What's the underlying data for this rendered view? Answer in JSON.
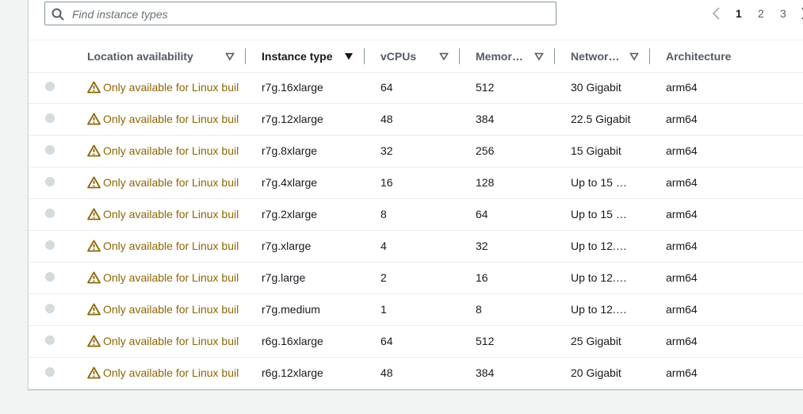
{
  "search": {
    "placeholder": "Find instance types",
    "value": ""
  },
  "pagination": {
    "pages": [
      "1",
      "2",
      "3"
    ],
    "current": "1"
  },
  "columns": [
    {
      "label": "Location availability",
      "sortable": true
    },
    {
      "label": "Instance type",
      "sortable": true,
      "sorted": "descending"
    },
    {
      "label": "vCPUs",
      "sortable": true
    },
    {
      "label": "Memor…",
      "sortable": true
    },
    {
      "label": "Networ…",
      "sortable": true
    },
    {
      "label": "Architecture",
      "sortable": false
    }
  ],
  "rows": [
    {
      "location": "Only available for Linux buil",
      "instance_type": "r7g.16xlarge",
      "vcpus": "64",
      "memory": "512",
      "network": "30 Gigabit",
      "architecture": "arm64"
    },
    {
      "location": "Only available for Linux buil",
      "instance_type": "r7g.12xlarge",
      "vcpus": "48",
      "memory": "384",
      "network": "22.5 Gigabit",
      "architecture": "arm64"
    },
    {
      "location": "Only available for Linux buil",
      "instance_type": "r7g.8xlarge",
      "vcpus": "32",
      "memory": "256",
      "network": "15 Gigabit",
      "architecture": "arm64"
    },
    {
      "location": "Only available for Linux buil",
      "instance_type": "r7g.4xlarge",
      "vcpus": "16",
      "memory": "128",
      "network": "Up to 15 …",
      "architecture": "arm64"
    },
    {
      "location": "Only available for Linux buil",
      "instance_type": "r7g.2xlarge",
      "vcpus": "8",
      "memory": "64",
      "network": "Up to 15 …",
      "architecture": "arm64"
    },
    {
      "location": "Only available for Linux buil",
      "instance_type": "r7g.xlarge",
      "vcpus": "4",
      "memory": "32",
      "network": "Up to 12.…",
      "architecture": "arm64"
    },
    {
      "location": "Only available for Linux buil",
      "instance_type": "r7g.large",
      "vcpus": "2",
      "memory": "16",
      "network": "Up to 12.…",
      "architecture": "arm64"
    },
    {
      "location": "Only available for Linux buil",
      "instance_type": "r7g.medium",
      "vcpus": "1",
      "memory": "8",
      "network": "Up to 12.…",
      "architecture": "arm64"
    },
    {
      "location": "Only available for Linux buil",
      "instance_type": "r6g.16xlarge",
      "vcpus": "64",
      "memory": "512",
      "network": "25 Gigabit",
      "architecture": "arm64"
    },
    {
      "location": "Only available for Linux buil",
      "instance_type": "r6g.12xlarge",
      "vcpus": "48",
      "memory": "384",
      "network": "20 Gigabit",
      "architecture": "arm64"
    }
  ],
  "colors": {
    "warning": "#8d6605",
    "radio": "#d5dbdb",
    "border": "#879596"
  },
  "icons": {
    "search": "search-icon",
    "warning": "warning-icon",
    "sort": "caret-down-icon",
    "prev": "chevron-left-icon"
  }
}
